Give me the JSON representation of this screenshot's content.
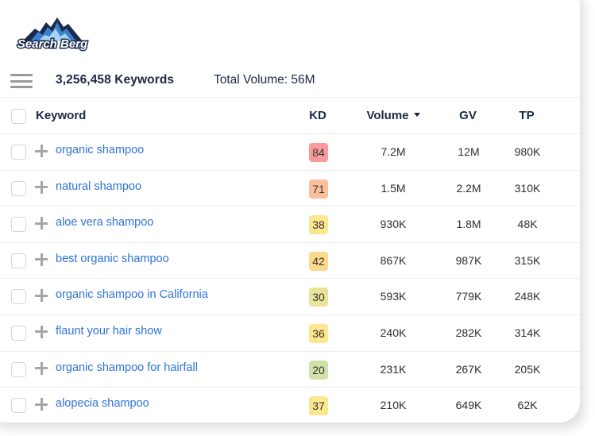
{
  "brand": {
    "name": "Search Berg"
  },
  "toolbar": {
    "menu_icon": "hamburger-menu-icon",
    "keyword_count": "3,256,458 Keywords",
    "total_volume": "Total Volume: 56M"
  },
  "table": {
    "headers": {
      "keyword": "Keyword",
      "kd": "KD",
      "volume": "Volume",
      "gv": "GV",
      "tp": "TP"
    },
    "sort": {
      "column": "volume",
      "direction": "desc",
      "icon": "caret-down-icon"
    },
    "rows": [
      {
        "keyword": "organic shampoo",
        "kd": "84",
        "kd_color": "#f99b9b",
        "volume": "7.2M",
        "gv": "12M",
        "tp": "980K"
      },
      {
        "keyword": "natural shampoo",
        "kd": "71",
        "kd_color": "#fcbf9c",
        "volume": "1.5M",
        "gv": "2.2M",
        "tp": "310K"
      },
      {
        "keyword": "aloe vera shampoo",
        "kd": "38",
        "kd_color": "#fce68e",
        "volume": "930K",
        "gv": "1.8M",
        "tp": "48K"
      },
      {
        "keyword": "best organic shampoo",
        "kd": "42",
        "kd_color": "#fcd98c",
        "volume": "867K",
        "gv": "987K",
        "tp": "315K"
      },
      {
        "keyword": "organic shampoo in California",
        "kd": "30",
        "kd_color": "#e8e59a",
        "volume": "593K",
        "gv": "779K",
        "tp": "248K"
      },
      {
        "keyword": "flaunt your hair show",
        "kd": "36",
        "kd_color": "#fce68e",
        "volume": "240K",
        "gv": "282K",
        "tp": "314K"
      },
      {
        "keyword": "organic shampoo for hairfall",
        "kd": "20",
        "kd_color": "#d2e1a7",
        "volume": "231K",
        "gv": "267K",
        "tp": "205K"
      },
      {
        "keyword": "alopecia shampoo",
        "kd": "37",
        "kd_color": "#fce68e",
        "volume": "210K",
        "gv": "649K",
        "tp": "62K"
      }
    ]
  }
}
